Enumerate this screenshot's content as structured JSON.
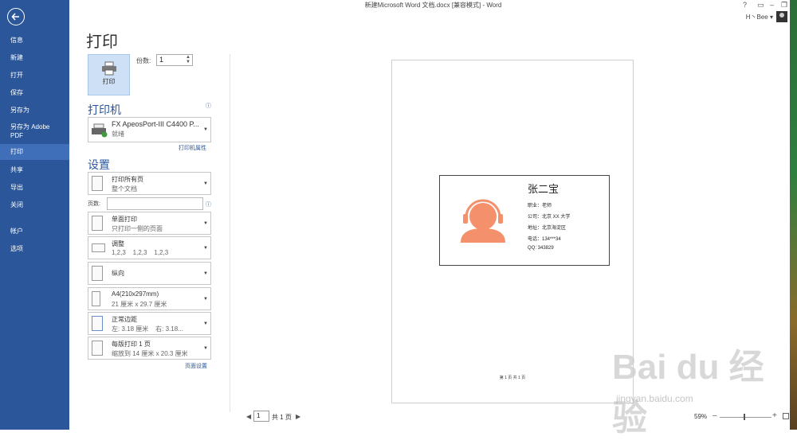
{
  "window": {
    "title": "新建Microsoft Word 文档.docx [兼容模式] - Word",
    "help": "?",
    "user": "H丶Bee"
  },
  "sidebar": {
    "items": [
      {
        "label": "信息"
      },
      {
        "label": "新建"
      },
      {
        "label": "打开"
      },
      {
        "label": "保存"
      },
      {
        "label": "另存为"
      },
      {
        "label": "另存为 Adobe PDF"
      },
      {
        "label": "打印"
      },
      {
        "label": "共享"
      },
      {
        "label": "导出"
      },
      {
        "label": "关闭"
      },
      {
        "label": "帐户"
      },
      {
        "label": "选项"
      }
    ],
    "active": "打印"
  },
  "print": {
    "title": "打印",
    "button": "打印",
    "copies_label": "份数:",
    "copies": "1",
    "printer_header": "打印机",
    "printer_name": "FX ApeosPort-III C4400 P...",
    "printer_status": "就绪",
    "printer_props": "打印机属性",
    "settings_header": "设置",
    "settings": [
      {
        "line1": "打印所有页",
        "line2": "整个文档"
      },
      {
        "line1": "单面打印",
        "line2": "只打印一侧的页面"
      },
      {
        "line1": "调整",
        "line2": "1,2,3    1,2,3    1,2,3"
      },
      {
        "line1": "纵向",
        "line2": ""
      },
      {
        "line1": "A4(210x297mm)",
        "line2": "21 厘米 x 29.7 厘米"
      },
      {
        "line1": "正常边距",
        "line2": "左: 3.18 厘米    右: 3.18..."
      },
      {
        "line1": "每版打印 1 页",
        "line2": "缩放到 14 厘米 x 20.3 厘米"
      }
    ],
    "pages_label": "页数:",
    "pages_value": "",
    "page_setup": "页面设置"
  },
  "preview": {
    "card": {
      "name": "张二宝",
      "lines": [
        "职业：老师",
        "公司：北京 XX 大学",
        "地址：北京海淀区",
        "电话：134***34",
        "QQ: 343829"
      ]
    },
    "footer": "第 1 页 共 1 页"
  },
  "status": {
    "prev": "◀",
    "current_page": "1",
    "total": "共 1 页",
    "next": "▶",
    "zoom": "59%"
  },
  "watermark": {
    "text": "Bai du 经验",
    "url": "jingyan.baidu.com"
  },
  "colors": {
    "accent": "#2b579a",
    "avatar": "#f4906c"
  }
}
